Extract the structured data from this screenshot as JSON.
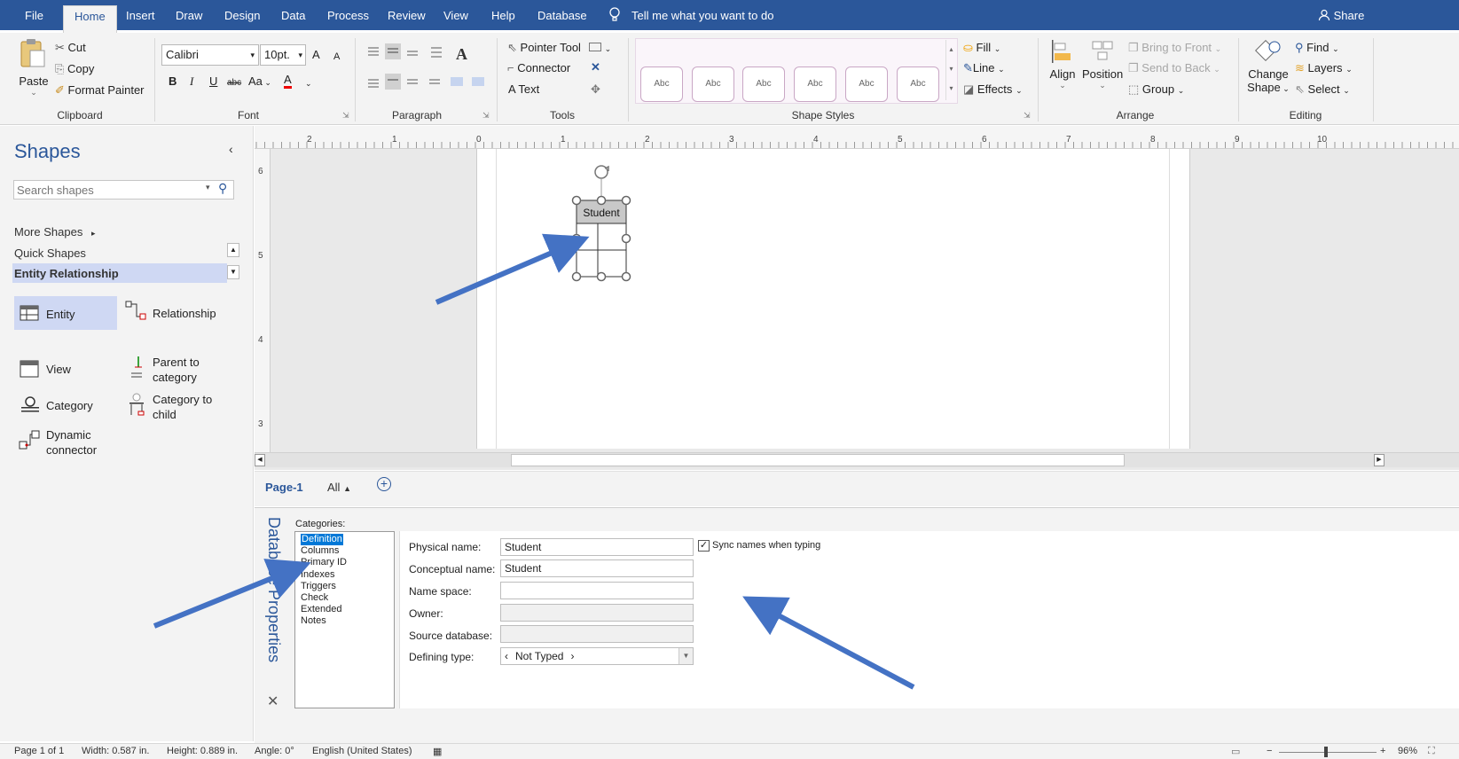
{
  "tabs": [
    "File",
    "Home",
    "Insert",
    "Draw",
    "Design",
    "Data",
    "Process",
    "Review",
    "View",
    "Help",
    "Database"
  ],
  "tell_me": "Tell me what you want to do",
  "share": "Share",
  "clipboard": {
    "paste": "Paste",
    "cut": "Cut",
    "copy": "Copy",
    "format_painter": "Format Painter",
    "label": "Clipboard"
  },
  "font": {
    "name": "Calibri",
    "size": "10pt.",
    "label": "Font",
    "bold": "B",
    "italic": "I",
    "underline": "U",
    "strike": "abc",
    "case": "Aa",
    "color": "A",
    "grow": "A",
    "shrink": "A"
  },
  "paragraph": {
    "label": "Paragraph"
  },
  "tools": {
    "pointer": "Pointer Tool",
    "connector": "Connector",
    "text": "Text",
    "label": "Tools"
  },
  "shape_styles": {
    "abc": "Abc",
    "fill": "Fill",
    "line": "Line",
    "effects": "Effects",
    "label": "Shape Styles"
  },
  "arrange": {
    "align": "Align",
    "position": "Position",
    "bring_front": "Bring to Front",
    "send_back": "Send to Back",
    "group": "Group",
    "label": "Arrange"
  },
  "editing": {
    "change_shape_1": "Change",
    "change_shape_2": "Shape",
    "find": "Find",
    "layers": "Layers",
    "select": "Select",
    "label": "Editing"
  },
  "shapes_pane": {
    "title": "Shapes",
    "search_placeholder": "Search shapes",
    "more_shapes": "More Shapes",
    "quick_shapes": "Quick Shapes",
    "stencil": "Entity Relationship",
    "items": {
      "entity": "Entity",
      "relationship": "Relationship",
      "view": "View",
      "parent_to_category_1": "Parent to",
      "parent_to_category_2": "category",
      "category": "Category",
      "category_to_child_1": "Category to",
      "category_to_child_2": "child",
      "dynamic_connector_1": "Dynamic",
      "dynamic_connector_2": "connector"
    }
  },
  "ruler": {
    "h": [
      "2",
      "1",
      "0",
      "1",
      "2",
      "3",
      "4",
      "5",
      "6",
      "7",
      "8",
      "9",
      "10"
    ],
    "v": [
      "6",
      "5",
      "4",
      "3"
    ]
  },
  "diagram": {
    "entity_title": "Student"
  },
  "page_tabs": {
    "page": "Page-1",
    "all": "All"
  },
  "db_props": {
    "title": "Database Properties",
    "categories_label": "Categories:",
    "categories": [
      "Definition",
      "Columns",
      "Primary ID",
      "Indexes",
      "Triggers",
      "Check",
      "Extended",
      "Notes"
    ],
    "physical_name_label": "Physical name:",
    "physical_name": "Student",
    "sync_label": "Sync names when typing",
    "conceptual_name_label": "Conceptual name:",
    "conceptual_name": "Student",
    "namespace_label": "Name space:",
    "namespace": "",
    "owner_label": "Owner:",
    "owner": "",
    "source_db_label": "Source database:",
    "source_db": "",
    "defining_type_label": "Defining type:",
    "defining_type": "Not Typed"
  },
  "status": {
    "page": "Page 1 of 1",
    "width": "Width: 0.587 in.",
    "height": "Height: 0.889 in.",
    "angle": "Angle: 0°",
    "language": "English (United States)",
    "zoom": "96%"
  },
  "colors": {
    "accent": "#2b579a",
    "arrow": "#4472c4",
    "selection": "#cfd8f3"
  }
}
